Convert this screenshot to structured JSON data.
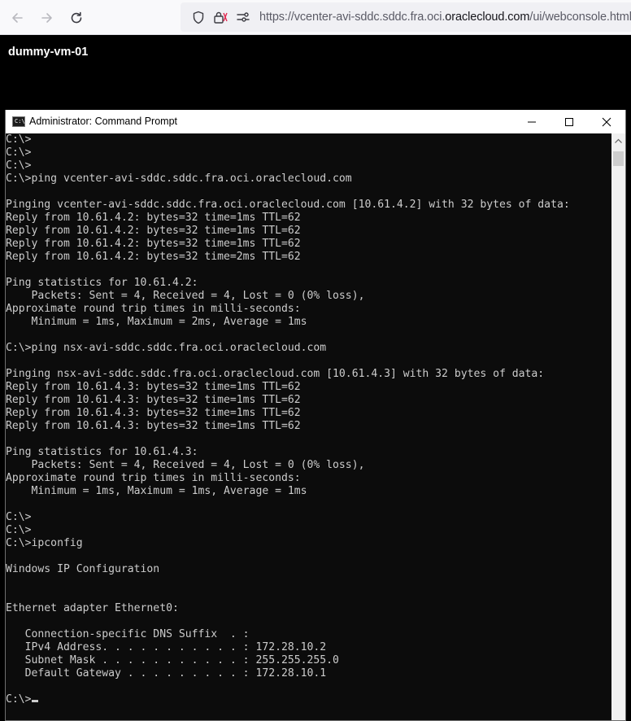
{
  "browser": {
    "url_prefix": "https://vcenter-avi-sddc.sddc.fra.oci.",
    "url_domain": "oraclecloud.com",
    "url_suffix": "/ui/webconsole.html?vm",
    "icons": [
      "back-arrow-icon",
      "forward-arrow-icon",
      "reload-icon",
      "shield-icon",
      "lock-icon",
      "permissions-icon"
    ]
  },
  "console": {
    "vm_name": "dummy-vm-01"
  },
  "cmd_window": {
    "title": "Administrator: Command Prompt",
    "icon_text": "C:\\",
    "lines": [
      "C:\\>",
      "C:\\>",
      "C:\\>",
      "C:\\>ping vcenter-avi-sddc.sddc.fra.oci.oraclecloud.com",
      "",
      "Pinging vcenter-avi-sddc.sddc.fra.oci.oraclecloud.com [10.61.4.2] with 32 bytes of data:",
      "Reply from 10.61.4.2: bytes=32 time=1ms TTL=62",
      "Reply from 10.61.4.2: bytes=32 time=1ms TTL=62",
      "Reply from 10.61.4.2: bytes=32 time=1ms TTL=62",
      "Reply from 10.61.4.2: bytes=32 time=2ms TTL=62",
      "",
      "Ping statistics for 10.61.4.2:",
      "    Packets: Sent = 4, Received = 4, Lost = 0 (0% loss),",
      "Approximate round trip times in milli-seconds:",
      "    Minimum = 1ms, Maximum = 2ms, Average = 1ms",
      "",
      "C:\\>ping nsx-avi-sddc.sddc.fra.oci.oraclecloud.com",
      "",
      "Pinging nsx-avi-sddc.sddc.fra.oci.oraclecloud.com [10.61.4.3] with 32 bytes of data:",
      "Reply from 10.61.4.3: bytes=32 time=1ms TTL=62",
      "Reply from 10.61.4.3: bytes=32 time=1ms TTL=62",
      "Reply from 10.61.4.3: bytes=32 time=1ms TTL=62",
      "Reply from 10.61.4.3: bytes=32 time=1ms TTL=62",
      "",
      "Ping statistics for 10.61.4.3:",
      "    Packets: Sent = 4, Received = 4, Lost = 0 (0% loss),",
      "Approximate round trip times in milli-seconds:",
      "    Minimum = 1ms, Maximum = 1ms, Average = 1ms",
      "",
      "C:\\>",
      "C:\\>",
      "C:\\>ipconfig",
      "",
      "Windows IP Configuration",
      "",
      "",
      "Ethernet adapter Ethernet0:",
      "",
      "   Connection-specific DNS Suffix  . :",
      "   IPv4 Address. . . . . . . . . . . : 172.28.10.2",
      "   Subnet Mask . . . . . . . . . . . : 255.255.255.0",
      "   Default Gateway . . . . . . . . . : 172.28.10.1",
      ""
    ],
    "prompt": "C:\\>",
    "buttons": [
      "minimize-icon",
      "maximize-icon",
      "close-icon"
    ]
  }
}
